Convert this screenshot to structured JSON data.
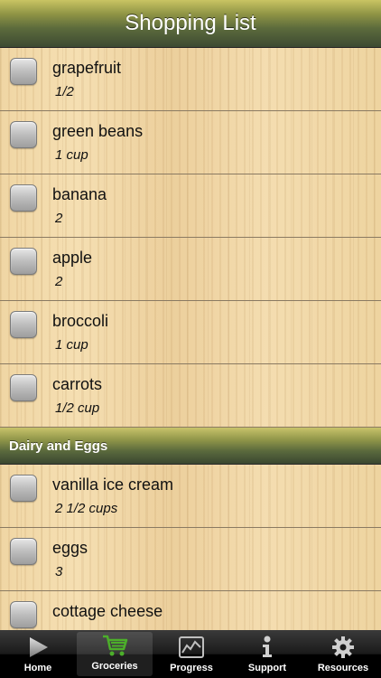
{
  "navbar": {
    "title": "Shopping List"
  },
  "items_top": [
    {
      "name": "grapefruit",
      "qty": "1/2"
    },
    {
      "name": "green beans",
      "qty": "1 cup"
    },
    {
      "name": "banana",
      "qty": "2"
    },
    {
      "name": "apple",
      "qty": "2"
    },
    {
      "name": "broccoli",
      "qty": "1 cup"
    },
    {
      "name": "carrots",
      "qty": "1/2 cup"
    }
  ],
  "section_dairy": {
    "title": "Dairy and Eggs"
  },
  "items_dairy": [
    {
      "name": "vanilla ice cream",
      "qty": "2 1/2 cups"
    },
    {
      "name": "eggs",
      "qty": "3"
    },
    {
      "name": "cottage cheese",
      "qty": ""
    }
  ],
  "tabs": [
    {
      "label": "Home",
      "icon": "play-icon"
    },
    {
      "label": "Groceries",
      "icon": "cart-icon"
    },
    {
      "label": "Progress",
      "icon": "chart-icon"
    },
    {
      "label": "Support",
      "icon": "info-icon"
    },
    {
      "label": "Resources",
      "icon": "gear-icon"
    }
  ],
  "colors": {
    "accent_green": "#5c6b3c",
    "cart_green": "#4caf2a"
  }
}
